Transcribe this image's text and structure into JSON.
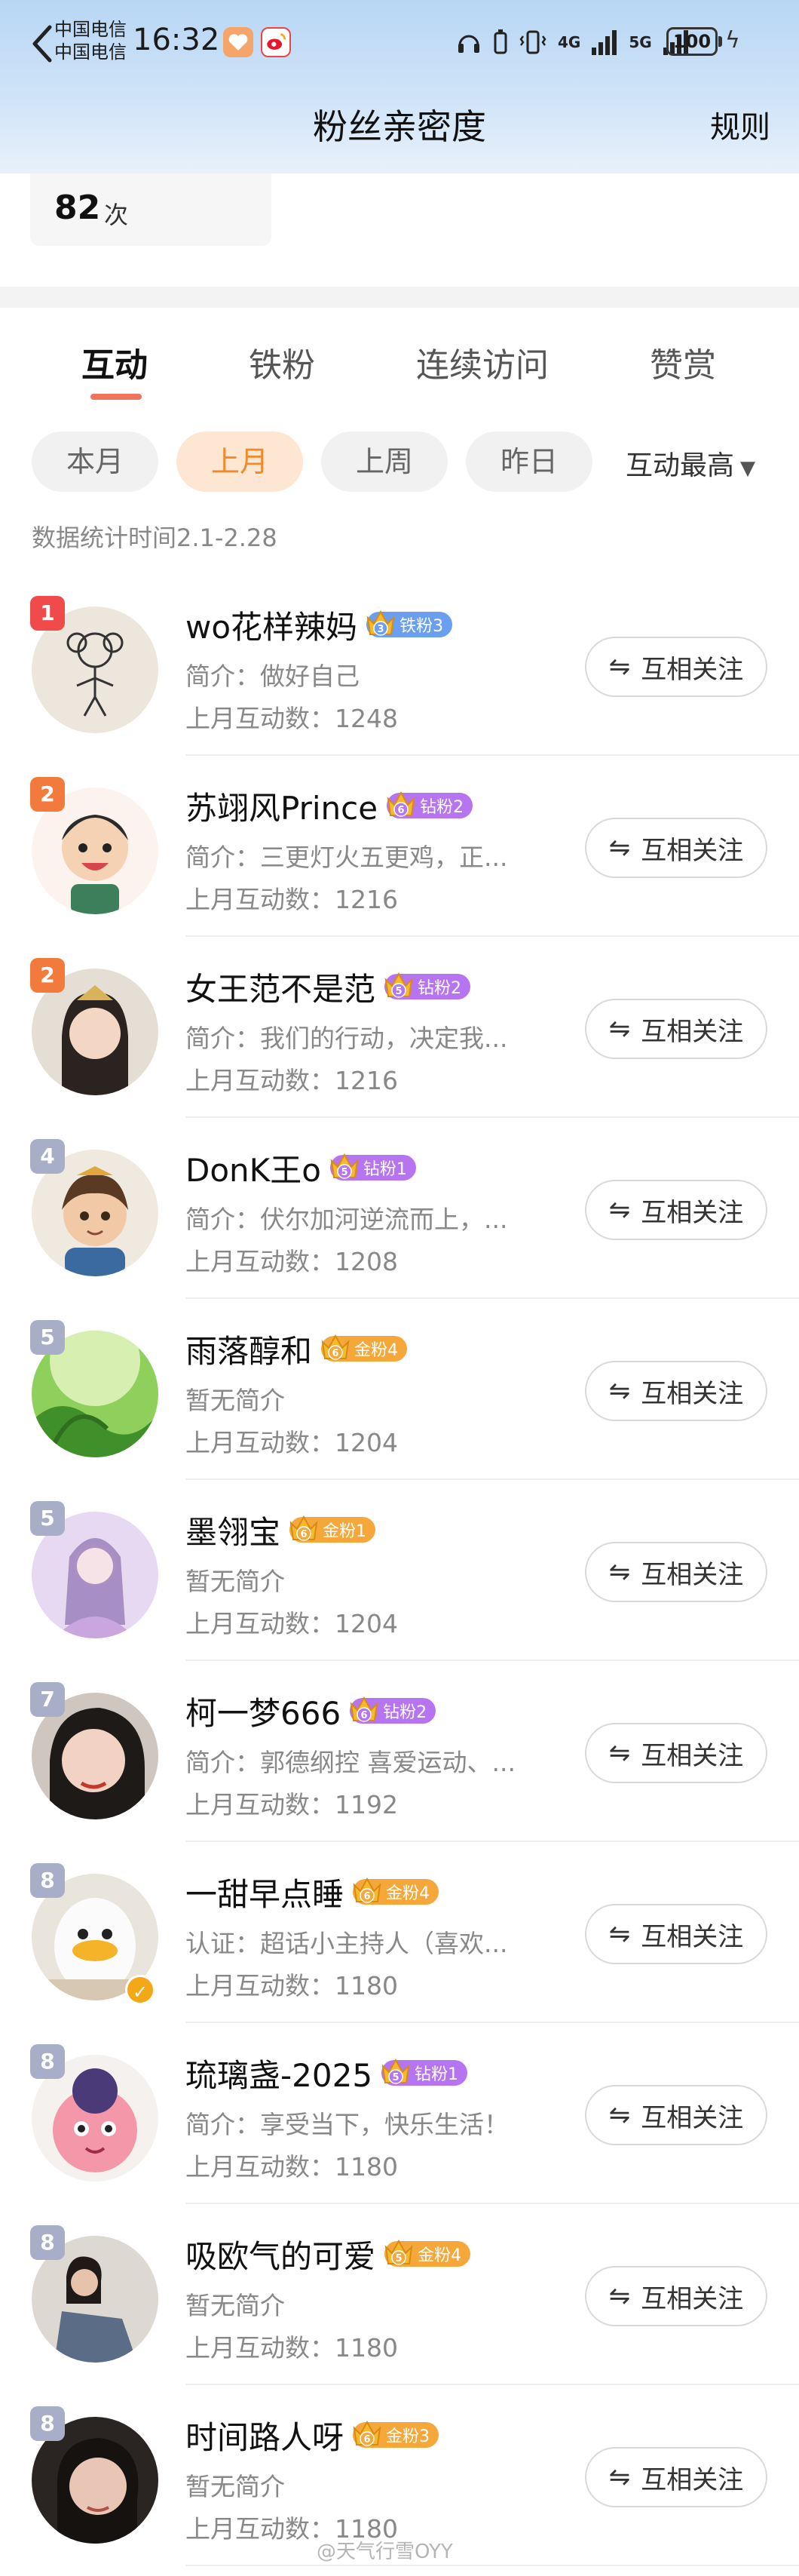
{
  "status_bar": {
    "carrier_1": "中国电信",
    "carrier_2": "中国电信",
    "time": "16:32",
    "signal_4g": "4G",
    "signal_5g": "5G",
    "battery": "100"
  },
  "header": {
    "title": "粉丝亲密度",
    "rules_label": "规则"
  },
  "summary": {
    "count": "82",
    "unit": "次"
  },
  "tabs": [
    {
      "label": "互动",
      "active": true
    },
    {
      "label": "铁粉",
      "active": false
    },
    {
      "label": "连续访问",
      "active": false
    },
    {
      "label": "赞赏",
      "active": false
    }
  ],
  "filters": [
    {
      "label": "本月",
      "active": false
    },
    {
      "label": "上月",
      "active": true
    },
    {
      "label": "上周",
      "active": false
    },
    {
      "label": "昨日",
      "active": false
    }
  ],
  "sort_label": "互动最高",
  "stat_time": "数据统计时间2.1-2.28",
  "follow_label": "互相关注",
  "colors": {
    "accent": "#f0735c",
    "chip_active_bg": "#fde7d2",
    "chip_active_text": "#f08a2a",
    "badge_iron": "#6a9ff0",
    "badge_diamond": "#b774f0",
    "badge_gold": "#f5a73a"
  },
  "fans": [
    {
      "rank": "1",
      "name": "wo花样辣妈",
      "badge_level": "3",
      "badge_text": "铁粉3",
      "badge_type": "iron",
      "bio": "简介：做好自己",
      "interactions": "上月互动数：1248"
    },
    {
      "rank": "2",
      "name": "苏翊风Prince",
      "badge_level": "6",
      "badge_text": "钻粉2",
      "badge_type": "diamond",
      "bio": "简介：三更灯火五更鸡，正...",
      "interactions": "上月互动数：1216"
    },
    {
      "rank": "2",
      "name": "女王范不是范",
      "badge_level": "5",
      "badge_text": "钻粉2",
      "badge_type": "diamond",
      "bio": "简介：我们的行动，决定我...",
      "interactions": "上月互动数：1216"
    },
    {
      "rank": "4",
      "name": "DonK王o",
      "badge_level": "5",
      "badge_text": "钻粉1",
      "badge_type": "diamond",
      "bio": "简介：伏尔加河逆流而上，...",
      "interactions": "上月互动数：1208"
    },
    {
      "rank": "5",
      "name": "雨落醇和",
      "badge_level": "6",
      "badge_text": "金粉4",
      "badge_type": "gold",
      "bio": "暂无简介",
      "interactions": "上月互动数：1204"
    },
    {
      "rank": "5",
      "name": "墨翎宝",
      "badge_level": "6",
      "badge_text": "金粉1",
      "badge_type": "gold",
      "bio": "暂无简介",
      "interactions": "上月互动数：1204"
    },
    {
      "rank": "7",
      "name": "柯一梦666",
      "badge_level": "6",
      "badge_text": "钻粉2",
      "badge_type": "diamond",
      "bio": "简介：郭德纲控 喜爱运动、...",
      "interactions": "上月互动数：1192"
    },
    {
      "rank": "8",
      "name": "一甜早点睡",
      "badge_level": "6",
      "badge_text": "金粉4",
      "badge_type": "gold",
      "bio": "认证：超话小主持人（喜欢...",
      "interactions": "上月互动数：1180",
      "verified": true
    },
    {
      "rank": "8",
      "name": "琉璃盏-2025",
      "badge_level": "5",
      "badge_text": "钻粉1",
      "badge_type": "diamond",
      "bio": "简介：享受当下，快乐生活！",
      "interactions": "上月互动数：1180"
    },
    {
      "rank": "8",
      "name": "吸欧气的可爱",
      "badge_level": "5",
      "badge_text": "金粉4",
      "badge_type": "gold",
      "bio": "暂无简介",
      "interactions": "上月互动数：1180"
    },
    {
      "rank": "8",
      "name": "时间路人呀",
      "badge_level": "6",
      "badge_text": "金粉3",
      "badge_type": "gold",
      "bio": "暂无简介",
      "interactions": "上月互动数：1180"
    }
  ],
  "watermark": "@天气行雪OYY"
}
